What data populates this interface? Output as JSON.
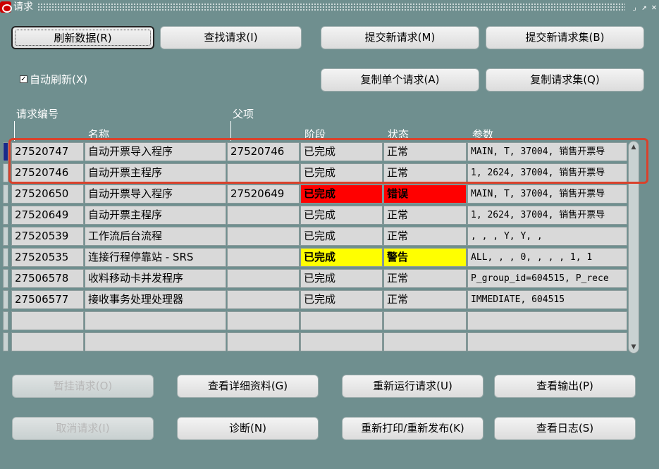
{
  "window": {
    "title": "请求",
    "controls": [
      "minimize-restore-icon",
      "maximize-icon",
      "close-icon"
    ]
  },
  "top_buttons": {
    "refresh": "刷新数据(R)",
    "find": "查找请求(I)",
    "submit_new": "提交新请求(M)",
    "submit_set": "提交新请求集(B)",
    "copy_single": "复制单个请求(A)",
    "copy_set": "复制请求集(Q)"
  },
  "auto_refresh": {
    "label": "自动刷新(X)",
    "checked": true
  },
  "headers": {
    "request_id": "请求编号",
    "parent": "父项",
    "name": "名称",
    "phase": "阶段",
    "status": "状态",
    "params": "参数"
  },
  "rows": [
    {
      "id": "27520747",
      "name": "自动开票导入程序",
      "parent": "27520746",
      "phase": "已完成",
      "status": "正常",
      "params": "MAIN, T, 37004, 销售开票导",
      "highlight": "none"
    },
    {
      "id": "27520746",
      "name": "自动开票主程序",
      "parent": "",
      "phase": "已完成",
      "status": "正常",
      "params": "1, 2624, 37004, 销售开票导",
      "highlight": "none"
    },
    {
      "id": "27520650",
      "name": "自动开票导入程序",
      "parent": "27520649",
      "phase": "已完成",
      "status": "错误",
      "params": "MAIN, T, 37004, 销售开票导",
      "highlight": "red"
    },
    {
      "id": "27520649",
      "name": "自动开票主程序",
      "parent": "",
      "phase": "已完成",
      "status": "正常",
      "params": "1, 2624, 37004, 销售开票导",
      "highlight": "none"
    },
    {
      "id": "27520539",
      "name": "工作流后台流程",
      "parent": "",
      "phase": "已完成",
      "status": "正常",
      "params": ", , , Y, Y, ,",
      "highlight": "none"
    },
    {
      "id": "27520535",
      "name": "连接行程停靠站 - SRS",
      "parent": "",
      "phase": "已完成",
      "status": "警告",
      "params": "ALL, , , 0, , , , 1, 1",
      "highlight": "yellow"
    },
    {
      "id": "27506578",
      "name": "收料移动卡并发程序",
      "parent": "",
      "phase": "已完成",
      "status": "正常",
      "params": "P_group_id=604515, P_rece",
      "highlight": "none"
    },
    {
      "id": "27506577",
      "name": "接收事务处理处理器",
      "parent": "",
      "phase": "已完成",
      "status": "正常",
      "params": "IMMEDIATE, 604515",
      "highlight": "none"
    },
    {
      "id": "",
      "name": "",
      "parent": "",
      "phase": "",
      "status": "",
      "params": "",
      "highlight": "none"
    },
    {
      "id": "",
      "name": "",
      "parent": "",
      "phase": "",
      "status": "",
      "params": "",
      "highlight": "none"
    }
  ],
  "bottom_buttons": {
    "hold": "暂挂请求(O)",
    "details": "查看详细资料(G)",
    "rerun": "重新运行请求(U)",
    "output": "查看输出(P)",
    "cancel": "取消请求(I)",
    "diagnose": "诊断(N)",
    "reprint": "重新打印/重新发布(K)",
    "log": "查看日志(S)"
  },
  "colors": {
    "background": "#6f8f8f",
    "error": "#ff0000",
    "warning": "#ffff00",
    "annotation": "#d9412b"
  }
}
